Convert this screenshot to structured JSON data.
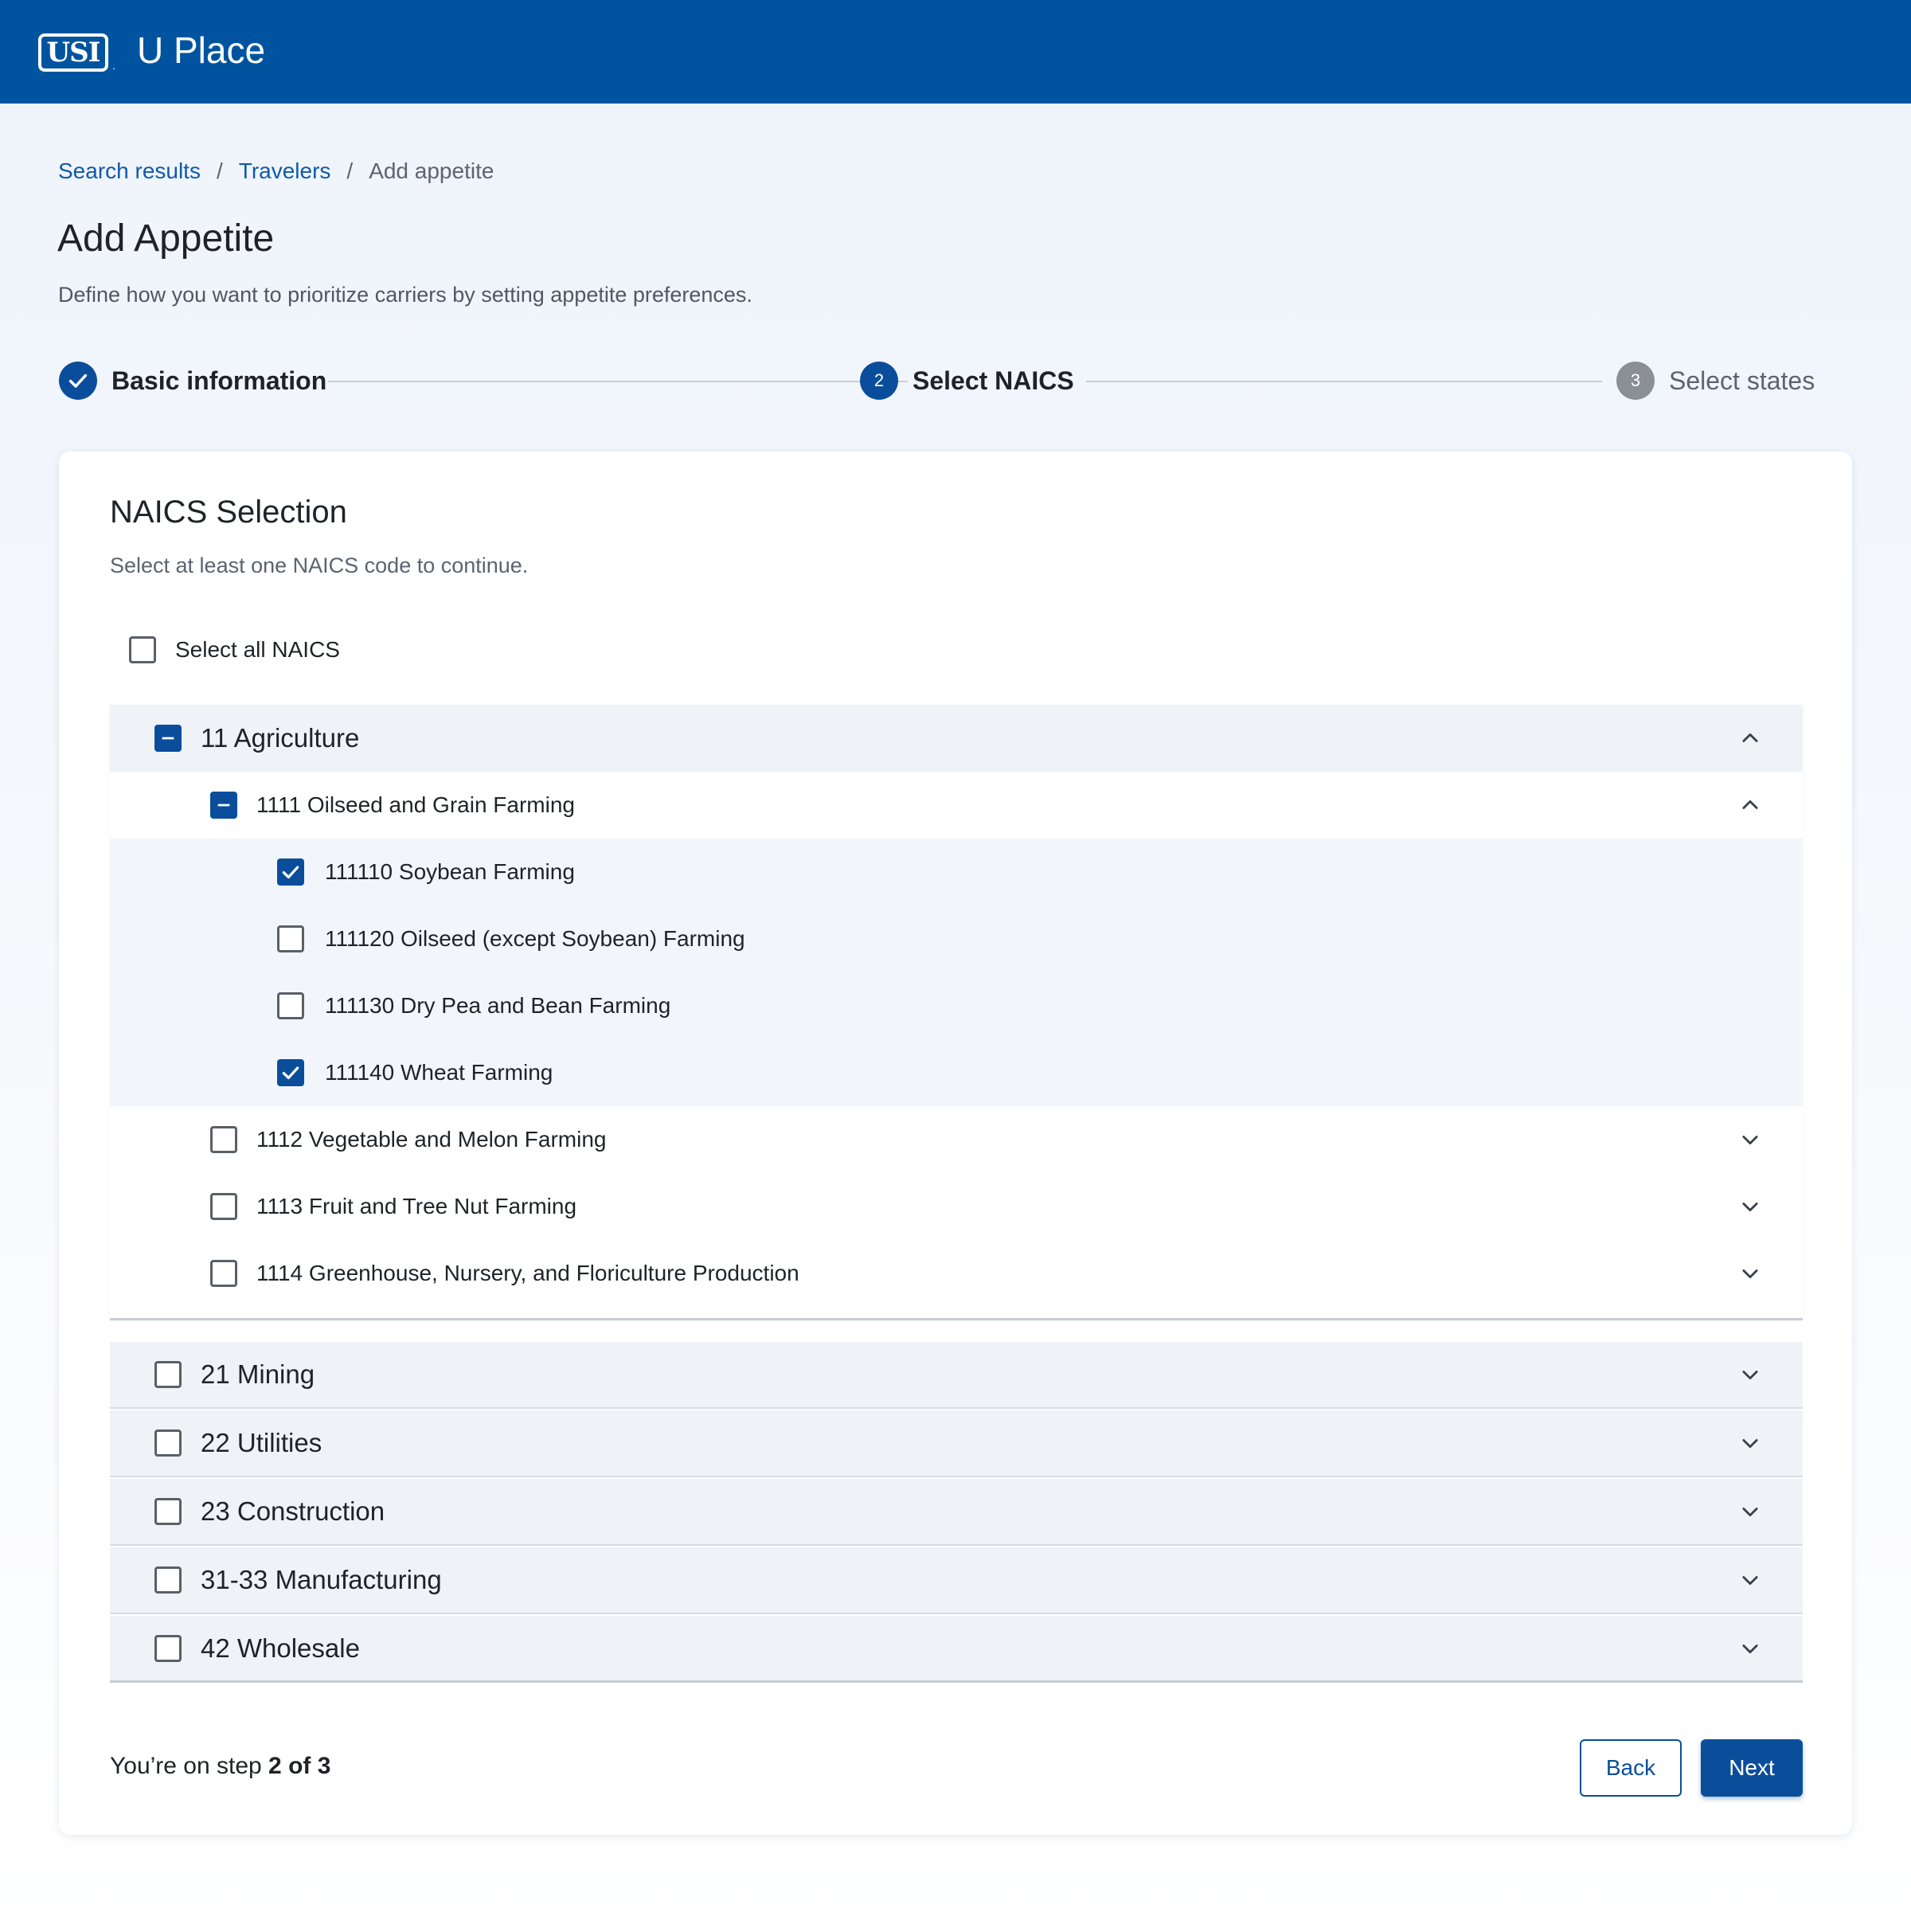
{
  "header": {
    "logo_text": "USI",
    "logo_mark": ".",
    "app_title": "U Place"
  },
  "breadcrumb": {
    "items": [
      "Search results",
      "Travelers"
    ],
    "current": "Add appetite",
    "separator": "/"
  },
  "page": {
    "title": "Add Appetite",
    "description": "Define how you want to prioritize carriers by setting appetite preferences."
  },
  "stepper": {
    "steps": [
      {
        "label": "Basic information",
        "state": "complete",
        "number": "1"
      },
      {
        "label": "Select NAICS",
        "state": "active",
        "number": "2"
      },
      {
        "label": "Select states",
        "state": "upcoming",
        "number": "3"
      }
    ]
  },
  "card": {
    "title": "NAICS Selection",
    "description": "Select at least one NAICS code to continue.",
    "select_all_label": "Select all NAICS",
    "sectors": [
      {
        "label": "11 Agriculture",
        "state": "partial",
        "expanded": true,
        "subsectors": [
          {
            "label": "1111 Oilseed and Grain Farming",
            "state": "partial",
            "expanded": true,
            "items": [
              {
                "label": "111110 Soybean Farming",
                "checked": true
              },
              {
                "label": "111120 Oilseed (except Soybean) Farming",
                "checked": false
              },
              {
                "label": "111130 Dry Pea and Bean Farming",
                "checked": false
              },
              {
                "label": "111140 Wheat Farming",
                "checked": true
              }
            ]
          },
          {
            "label": "1112 Vegetable and Melon Farming",
            "state": "unchecked",
            "expanded": false
          },
          {
            "label": "1113 Fruit and Tree Nut Farming",
            "state": "unchecked",
            "expanded": false
          },
          {
            "label": "1114 Greenhouse, Nursery, and Floriculture Production",
            "state": "unchecked",
            "expanded": false
          }
        ]
      },
      {
        "label": "21 Mining",
        "state": "unchecked",
        "expanded": false
      },
      {
        "label": "22 Utilities",
        "state": "unchecked",
        "expanded": false
      },
      {
        "label": "23 Construction",
        "state": "unchecked",
        "expanded": false
      },
      {
        "label": "31-33 Manufacturing",
        "state": "unchecked",
        "expanded": false
      },
      {
        "label": "42 Wholesale",
        "state": "unchecked",
        "expanded": false
      }
    ],
    "footer": {
      "prefix": "You’re on step ",
      "step_text": "2 of 3"
    },
    "buttons": {
      "back": "Back",
      "next": "Next"
    }
  },
  "colors": {
    "brand": "#00549f",
    "primary": "#0a4e9b",
    "link": "#0f5aa8",
    "muted_text": "#5b6470",
    "row_bg": "#eff3f8"
  },
  "icons": {
    "check": "check-icon",
    "partial": "minus-icon",
    "expanded": "chevron-up-icon",
    "collapsed": "chevron-down-icon"
  }
}
